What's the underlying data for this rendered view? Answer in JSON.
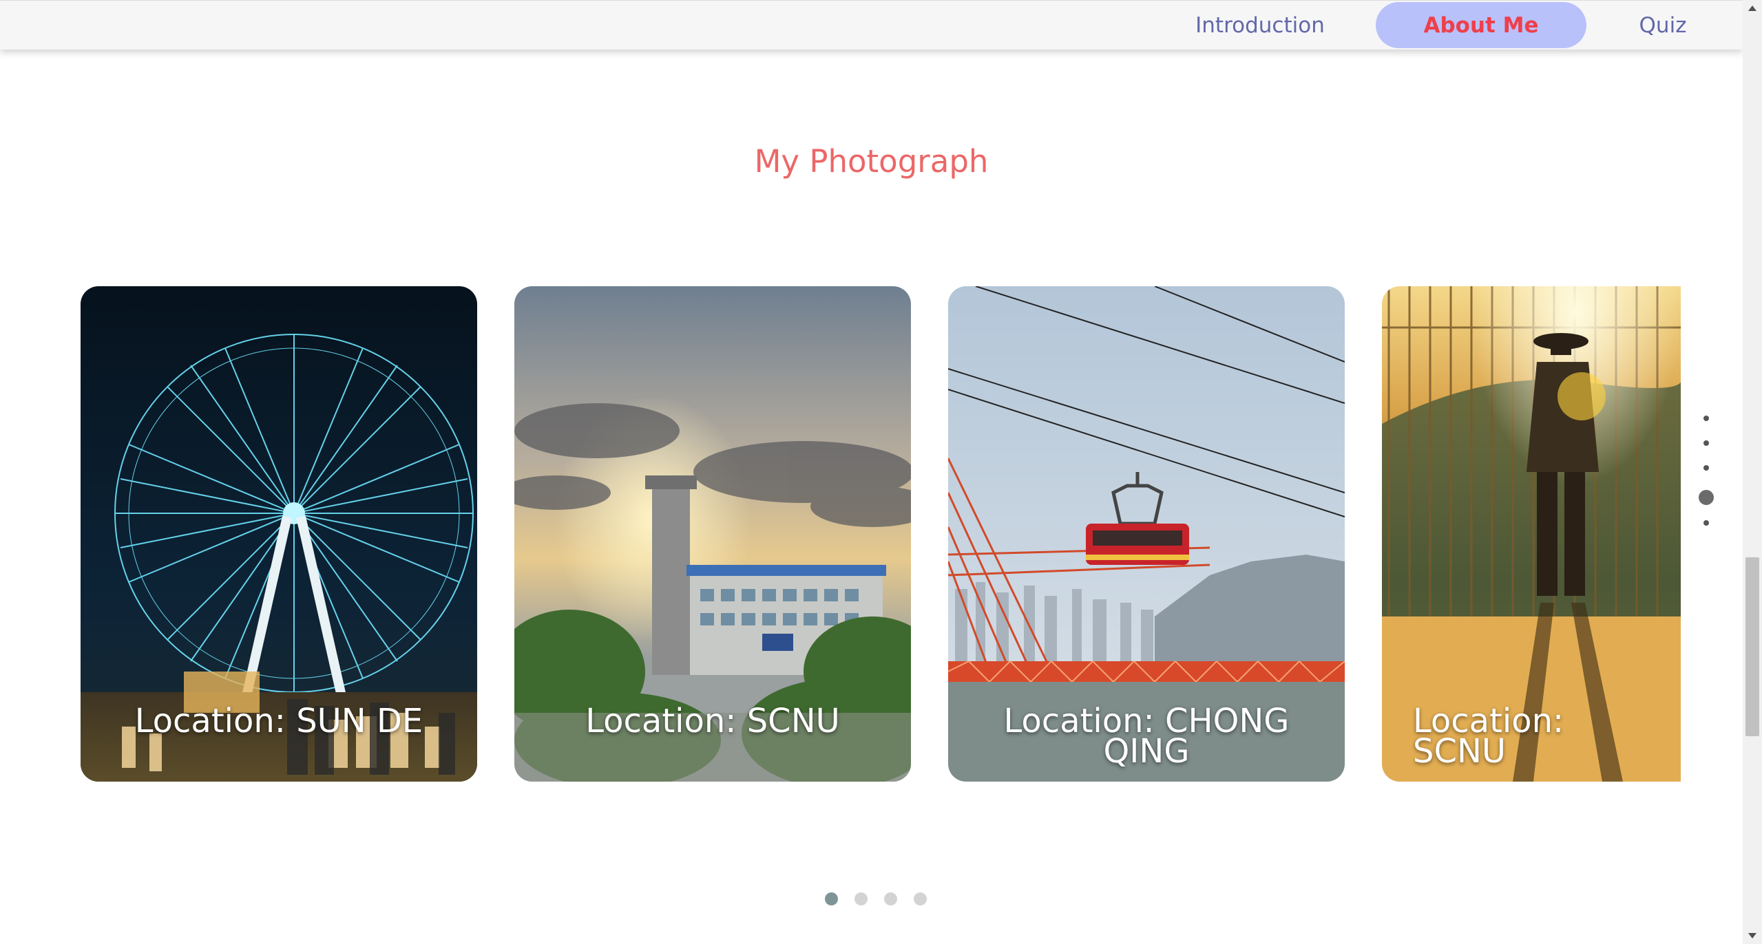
{
  "nav": {
    "items": [
      {
        "label": "Introduction"
      },
      {
        "label": "About Me",
        "active": true
      },
      {
        "label": "Quiz"
      }
    ]
  },
  "section": {
    "title": "My Photograph"
  },
  "cards": [
    {
      "caption": "Location: SUN DE"
    },
    {
      "caption": "Location: SCNU"
    },
    {
      "caption": "Location: CHONG QING"
    },
    {
      "caption": "Location: SCNU"
    }
  ],
  "carousel": {
    "total": 4,
    "active_index": 0
  },
  "side_nav": {
    "total": 5,
    "active_index": 3
  },
  "colors": {
    "title": "#ec6767",
    "nav_text": "#6268a8",
    "nav_active_bg": "#b9c1fb",
    "nav_active_text": "#ef3f4a"
  }
}
